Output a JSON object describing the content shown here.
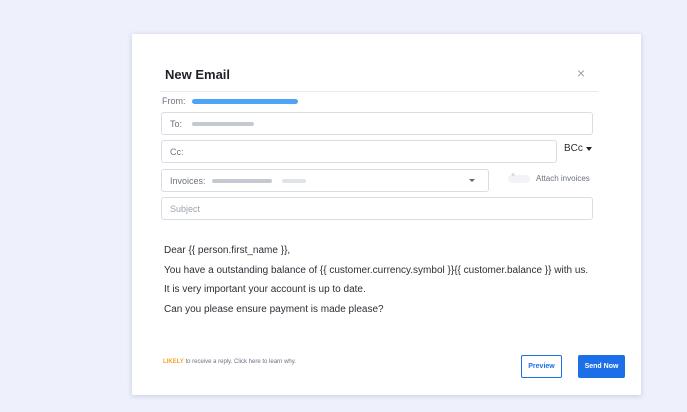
{
  "modal": {
    "title": "New Email",
    "close_glyph": "×"
  },
  "from": {
    "label": "From:"
  },
  "to": {
    "label": "To:"
  },
  "cc": {
    "label": "Cc:"
  },
  "bcc": {
    "label": "BCc"
  },
  "invoices": {
    "label": "Invoices:"
  },
  "attach": {
    "label": "Attach invoices",
    "toggle_glyph": "×"
  },
  "subject": {
    "placeholder": "Subject"
  },
  "body": {
    "lines": [
      "Dear {{ person.first_name }},",
      "You have a outstanding balance of {{ customer.currency.symbol }}{{ customer.balance }} with us.",
      "It is very important your account is up to date.",
      "Can you please ensure payment is made please?"
    ]
  },
  "footer": {
    "likely": "LIKELY",
    "note": " to receive a reply. Click here to learn why."
  },
  "buttons": {
    "preview": "Preview",
    "send": "Send Now"
  },
  "colors": {
    "accent": "#1d6fe8",
    "likely": "#f5a623",
    "background": "#eef1fb"
  },
  "icons": [
    "close-icon",
    "chevron-down-icon"
  ]
}
